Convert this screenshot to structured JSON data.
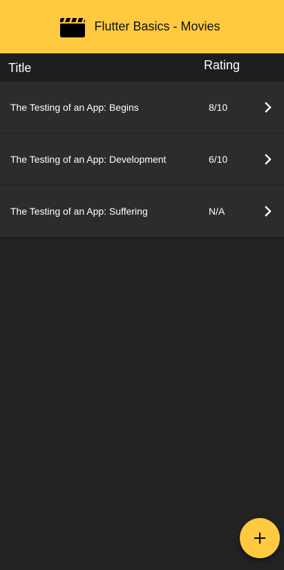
{
  "app_bar": {
    "icon": "movie-clapperboard-icon",
    "title": "Flutter Basics - Movies",
    "color": "#FFC940"
  },
  "columns": {
    "title": "Title",
    "rating": "Rating"
  },
  "movies": [
    {
      "title": "The Testing of an App: Begins",
      "rating": "8/10"
    },
    {
      "title": "The Testing of an App: Development",
      "rating": "6/10"
    },
    {
      "title": "The Testing of an App: Suffering",
      "rating": "N/A"
    }
  ],
  "fab": {
    "icon": "plus-icon"
  },
  "colors": {
    "background": "#222222",
    "row": "#2C2C2C",
    "accent": "#FFC940"
  }
}
